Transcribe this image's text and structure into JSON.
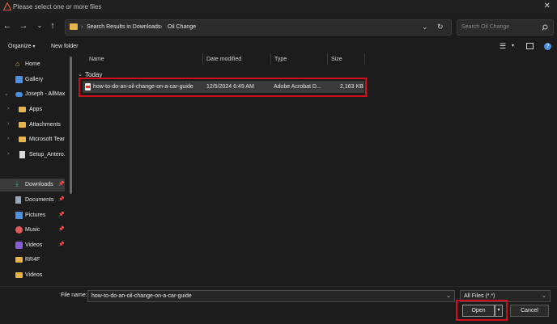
{
  "window": {
    "title": "Please select one or more files"
  },
  "address": {
    "breadcrumbs": [
      "Search Results in Downloads",
      "Oil Change"
    ],
    "separator": "›"
  },
  "search": {
    "placeholder": "Search Oil Change"
  },
  "toolbar": {
    "organize": "Organize",
    "new_folder": "New folder"
  },
  "sidebar": {
    "items": [
      {
        "label": "Home",
        "icon": "home-icon"
      },
      {
        "label": "Gallery",
        "icon": "gallery-icon"
      },
      {
        "label": "Joseph - AllMax",
        "icon": "onedrive-icon"
      },
      {
        "label": "Apps",
        "icon": "folder-icon"
      },
      {
        "label": "Attachments",
        "icon": "folder-icon"
      },
      {
        "label": "Microsoft Tear",
        "icon": "folder-icon"
      },
      {
        "label": "Setup_Antero.e",
        "icon": "file-icon"
      },
      {
        "label": "Downloads",
        "icon": "download-icon"
      },
      {
        "label": "Documents",
        "icon": "documents-icon"
      },
      {
        "label": "Pictures",
        "icon": "pictures-icon"
      },
      {
        "label": "Music",
        "icon": "music-icon"
      },
      {
        "label": "Videos",
        "icon": "videos-icon"
      },
      {
        "label": "RR4F",
        "icon": "folder-icon"
      },
      {
        "label": "Videos",
        "icon": "folder-icon"
      }
    ]
  },
  "columns": {
    "name": "Name",
    "date": "Date modified",
    "type": "Type",
    "size": "Size"
  },
  "group": {
    "label": "Today"
  },
  "files": [
    {
      "name": "how-to-do-an-oil-change-on-a-car-guide",
      "date": "12/5/2024 6:49 AM",
      "type": "Adobe Acrobat D...",
      "size": "2,163 KB"
    }
  ],
  "bottom": {
    "file_name_label": "File name:",
    "file_name_value": "how-to-do-an-oil-change-on-a-car-guide",
    "file_type": "All Files (*.*)",
    "open": "Open",
    "cancel": "Cancel"
  },
  "colors": {
    "highlight": "#d10f1c",
    "folder": "#e8b44a",
    "accent": "#4a90e2"
  }
}
